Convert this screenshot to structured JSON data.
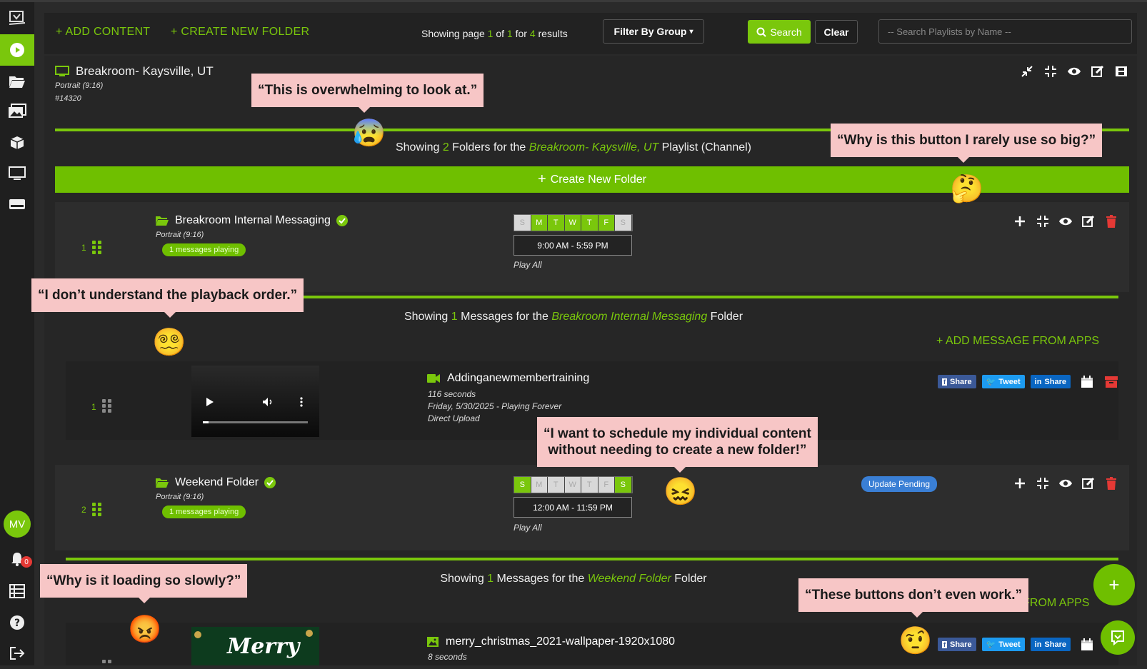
{
  "toolbar": {
    "add_content": "ADD CONTENT",
    "create_folder": "CREATE NEW FOLDER",
    "paging_prefix": "Showing page",
    "page": "1",
    "paging_of": "of",
    "pages": "1",
    "paging_for": "for",
    "results_count": "4",
    "paging_results": "results",
    "filter_label": "Filter By Group",
    "search_label": "Search",
    "clear_label": "Clear",
    "search_placeholder": "-- Search Playlists by Name --"
  },
  "channel": {
    "title": "Breakroom- Kaysville, UT",
    "orientation": "Portrait (9:16)",
    "id": "#14320",
    "showing_prefix": "Showing",
    "folder_count": "2",
    "showing_mid": "Folders for the",
    "showing_name": "Breakroom- Kaysville, UT",
    "showing_suffix": "Playlist (Channel)",
    "create_folder_bar": "Create New Folder"
  },
  "folders": [
    {
      "num": "1",
      "name": "Breakroom Internal Messaging",
      "orientation": "Portrait (9:16)",
      "playing": "1 messages playing",
      "days": [
        "S",
        "M",
        "T",
        "W",
        "T",
        "F",
        "S"
      ],
      "time": "9:00 AM - 5:59 PM",
      "play_mode": "Play All",
      "msg_showing_prefix": "Showing",
      "msg_count": "1",
      "msg_showing_mid": "Messages for the",
      "msg_showing_name": "Breakroom Internal Messaging",
      "msg_showing_suffix": "Folder",
      "add_msg": "ADD MESSAGE FROM APPS"
    },
    {
      "num": "2",
      "name": "Weekend Folder",
      "orientation": "Portrait (9:16)",
      "playing": "1 messages playing",
      "days": [
        "S",
        "M",
        "T",
        "W",
        "T",
        "F",
        "S"
      ],
      "time": "12:00 AM - 11:59 PM",
      "play_mode": "Play All",
      "status": "Update Pending",
      "msg_showing_prefix": "Showing",
      "msg_count": "1",
      "msg_showing_mid": "Messages for the",
      "msg_showing_name": "Weekend Folder",
      "msg_showing_suffix": "Folder",
      "add_msg_tail": "E FROM APPS"
    }
  ],
  "messages": [
    {
      "num": "1",
      "title": "Addinganewmembertraining",
      "duration": "116 seconds",
      "schedule": "Friday, 5/30/2025 - Playing Forever",
      "source": "Direct Upload",
      "icon": "video-camera-icon"
    },
    {
      "title": "merry_christmas_2021-wallpaper-1920x1080",
      "duration": "8 seconds",
      "thumb_text": "Merry",
      "icon": "image-icon"
    }
  ],
  "social": {
    "share": "Share",
    "tweet": "Tweet",
    "linkedin": "Share"
  },
  "sidebar": {
    "avatar": "MV",
    "notifications": "0"
  },
  "callouts": [
    {
      "text": "“This is overwhelming to look at.”",
      "emoji": "😰"
    },
    {
      "text": "“Why is this button I rarely use so big?”",
      "emoji": "🤔"
    },
    {
      "text": "“I don’t understand the playback order.”",
      "emoji": "😵‍💫"
    },
    {
      "line1": "“I want to schedule my individual content",
      "line2": "without needing to create a new folder!”",
      "emoji": "😖"
    },
    {
      "text": "“Why is it loading so slowly?”",
      "emoji": "😡"
    },
    {
      "text": "“These buttons don’t even work.”",
      "emoji": "🤨"
    }
  ],
  "colors": {
    "accent": "#7ac70c",
    "callout": "#f7c6c6",
    "danger": "#e53935",
    "pending": "#3a7fd5"
  }
}
